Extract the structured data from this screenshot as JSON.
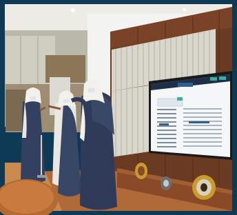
{
  "photo": {
    "scene": "meeting-room",
    "colors": {
      "border": "#0f3a55",
      "ceiling": "#ecebe5",
      "left_wall": "#b9b8aa",
      "wood_dark": "#5a2e1a",
      "wood_mid": "#7a4227",
      "slats": "#d9d6cc",
      "right_wall": "#f3f3f1",
      "floor": "#b06a3a",
      "thobe_dark": "#33405f",
      "thobe_light": "#e9e7e1",
      "screen_header": "#1e2f4a",
      "screen_bg": "#f4f6f8",
      "ring": "#c99a2e"
    }
  },
  "screen": {
    "header_text": "",
    "panel_badge": "",
    "rows": 10
  }
}
